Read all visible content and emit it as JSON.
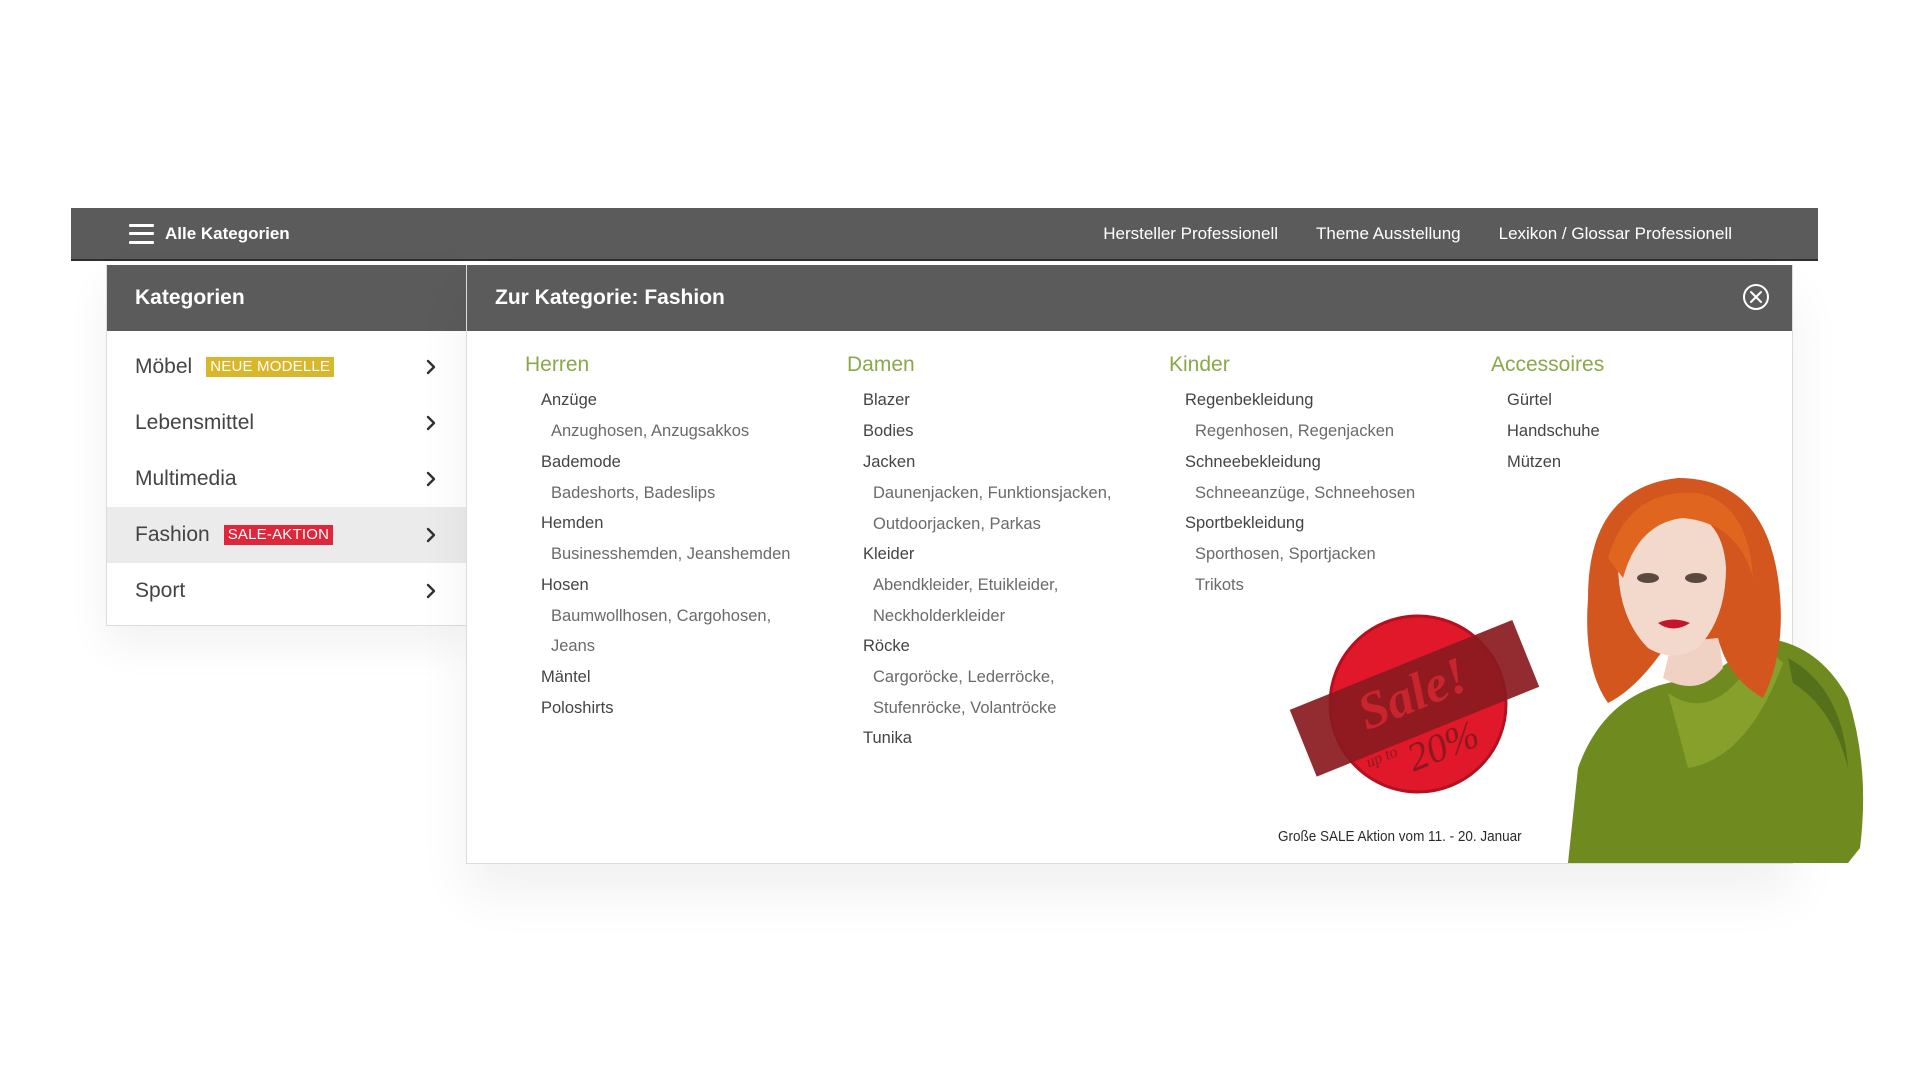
{
  "topbar": {
    "all_categories": "Alle Kategorien",
    "links": [
      "Hersteller Professionell",
      "Theme Ausstellung",
      "Lexikon / Glossar Professionell"
    ]
  },
  "sidebar": {
    "title": "Kategorien",
    "items": [
      {
        "label": "Möbel",
        "badge": "NEUE MODELLE",
        "badge_color": "#d9b72d"
      },
      {
        "label": "Lebensmittel"
      },
      {
        "label": "Multimedia"
      },
      {
        "label": "Fashion",
        "badge": "SALE-AKTION",
        "badge_color": "#e0263a",
        "active": true
      },
      {
        "label": "Sport"
      }
    ]
  },
  "panel": {
    "title": "Zur Kategorie: Fashion",
    "accent_color": "#8aa84a",
    "columns": [
      {
        "heading": "Herren",
        "entries": [
          {
            "label": "Anzüge",
            "subs": [
              "Anzughosen,",
              "Anzugsakkos"
            ]
          },
          {
            "label": "Bademode",
            "subs": [
              "Badeshorts,",
              "Badeslips"
            ]
          },
          {
            "label": "Hemden",
            "subs": [
              "Businesshemden,",
              "Jeanshemden"
            ]
          },
          {
            "label": "Hosen",
            "subs": [
              "Baumwollhosen,",
              "Cargohosen,",
              "Jeans"
            ]
          },
          {
            "label": "Mäntel",
            "subs": []
          },
          {
            "label": "Poloshirts",
            "subs": []
          }
        ]
      },
      {
        "heading": "Damen",
        "entries": [
          {
            "label": "Blazer",
            "subs": []
          },
          {
            "label": "Bodies",
            "subs": []
          },
          {
            "label": "Jacken",
            "subs": [
              "Daunenjacken,",
              "Funktionsjacken,",
              "Outdoorjacken,",
              "Parkas"
            ]
          },
          {
            "label": "Kleider",
            "subs": [
              "Abendkleider,",
              "Etuikleider,",
              "Neckholderkleider"
            ]
          },
          {
            "label": "Röcke",
            "subs": [
              "Cargoröcke,",
              "Lederröcke,",
              "Stufenröcke,",
              "Volantröcke"
            ]
          },
          {
            "label": "Tunika",
            "subs": []
          }
        ]
      },
      {
        "heading": "Kinder",
        "entries": [
          {
            "label": "Regenbekleidung",
            "subs": [
              "Regenhosen,",
              "Regenjacken"
            ]
          },
          {
            "label": "Schneebekleidung",
            "subs": [
              "Schneeanzüge,",
              "Schneehosen"
            ]
          },
          {
            "label": "Sportbekleidung",
            "subs": [
              "Sporthosen,",
              "Sportjacken"
            ]
          },
          {
            "label": "Trikots",
            "subs": [],
            "sub_style": true
          }
        ]
      },
      {
        "heading": "Accessoires",
        "entries": [
          {
            "label": "Gürtel",
            "subs": []
          },
          {
            "label": "Handschuhe",
            "subs": []
          },
          {
            "label": "Mützen",
            "subs": []
          }
        ]
      }
    ]
  },
  "promo": {
    "sale_word": "Sale!",
    "up_to": "up to",
    "percent": "20%",
    "caption": "Große SALE Aktion vom 11. - 20. Januar"
  }
}
